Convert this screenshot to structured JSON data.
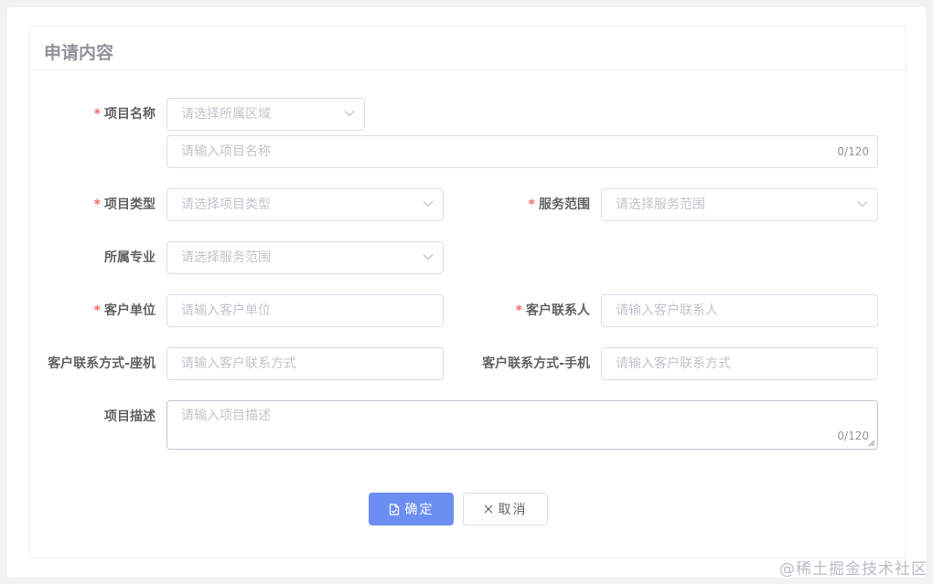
{
  "card": {
    "title": "申请内容"
  },
  "form": {
    "project_name": {
      "label": "项目名称",
      "required": true,
      "region_placeholder": "请选择所属区域",
      "name_placeholder": "请输入项目名称",
      "name_counter": "0/120"
    },
    "project_type": {
      "label": "项目类型",
      "required": true,
      "placeholder": "请选择项目类型"
    },
    "service_scope": {
      "label": "服务范围",
      "required": true,
      "placeholder": "请选择服务范围"
    },
    "specialty": {
      "label": "所属专业",
      "required": false,
      "placeholder": "请选择服务范围"
    },
    "client_unit": {
      "label": "客户单位",
      "required": true,
      "placeholder": "请输入客户单位"
    },
    "client_contact": {
      "label": "客户联系人",
      "required": true,
      "placeholder": "请输入客户联系人"
    },
    "client_landline": {
      "label": "客户联系方式-座机",
      "required": false,
      "placeholder": "请输入客户联系方式"
    },
    "client_mobile": {
      "label": "客户联系方式-手机",
      "required": false,
      "placeholder": "请输入客户联系方式"
    },
    "description": {
      "label": "项目描述",
      "required": false,
      "placeholder": "请输入项目描述",
      "counter": "0/120"
    }
  },
  "actions": {
    "confirm_label": "确定",
    "cancel_label": "取消"
  },
  "watermark": "@稀土掘金技术社区",
  "icons": {
    "select_arrow": "chevron-down-icon",
    "confirm": "document-icon",
    "cancel": "close-icon"
  },
  "colors": {
    "primary": "#6b8ef3",
    "required_star": "#f56c6c",
    "placeholder": "#c0c4cc",
    "border": "#dcdfe6"
  }
}
